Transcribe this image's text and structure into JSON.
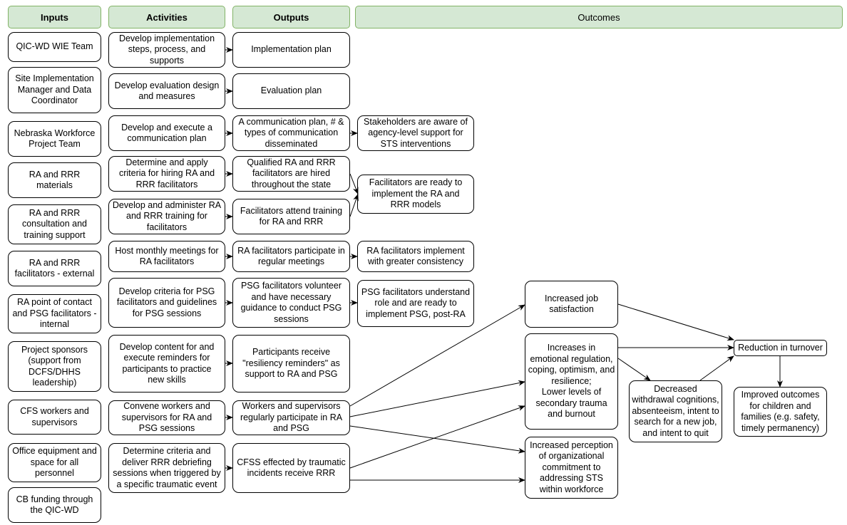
{
  "headers": {
    "inputs": "Inputs",
    "activities": "Activities",
    "outputs": "Outputs",
    "outcomes": "Outcomes"
  },
  "inputs": [
    "QIC-WD WIE Team",
    "Site Implementation\nManager and Data\nCoordinator",
    "Nebraska Workforce\nProject Team",
    "RA and RRR\nmaterials",
    "RA and RRR\nconsultation and\ntraining support",
    "RA and RRR\nfacilitators - external",
    "RA point of contact\nand PSG facilitators -\ninternal",
    "Project sponsors\n(support from\nDCFS/DHHS\nleadership)",
    "CFS workers and\nsupervisors",
    "Office equipment and\nspace for all\npersonnel",
    "CB funding through\nthe QIC-WD"
  ],
  "activities": [
    "Develop implementation\nsteps, process, and\nsupports",
    "Develop evaluation design\nand measures",
    "Develop and execute a\ncommunication plan",
    "Determine and apply\ncriteria for hiring RA and\nRRR facilitators",
    "Develop and administer RA\nand RRR training for\nfacilitators",
    "Host monthly meetings for\nRA facilitators",
    "Develop criteria for PSG\nfacilitators and guidelines\nfor PSG sessions",
    "Develop content for and\nexecute reminders for\nparticipants to practice\nnew skills",
    "Convene workers and\nsupervisors for RA and\nPSG sessions",
    "Determine criteria and\ndeliver RRR debriefing\nsessions when triggered by\na specific traumatic event"
  ],
  "outputs": [
    "Implementation plan",
    "Evaluation plan",
    "A communication plan, # &\ntypes of communication\ndisseminated",
    "Qualified RA and RRR\nfacilitators are hired\nthroughout the state",
    "Facilitators attend training\nfor RA and RRR",
    "RA facilitators participate in\nregular meetings",
    "PSG facilitators volunteer\nand have necessary\nguidance to conduct PSG\nsessions",
    "Participants receive\n\"resiliency reminders\" as\nsupport to RA and PSG",
    "Workers and supervisors\nregularly participate in RA\nand PSG",
    "CFSS effected by traumatic\nincidents receive RRR"
  ],
  "short_outcomes": [
    "Stakeholders are aware of\nagency-level support for\nSTS interventions",
    "Facilitators are ready to\nimplement the RA and\nRRR models",
    "RA facilitators implement\nwith greater consistency",
    "PSG facilitators understand\nrole and are ready to\nimplement PSG, post-RA"
  ],
  "mid_outcomes": [
    "Increased job\nsatisfaction",
    "Increases in\nemotional regulation,\ncoping, optimism, and\nresilience;\nLower levels of\nsecondary trauma\nand burnout",
    "Increased perception\nof organizational\ncommitment to\naddressing STS\nwithin workforce"
  ],
  "long_outcomes": {
    "withdrawal": "Decreased\nwithdrawal cognitions,\nabsenteeism, intent to\nsearch for a new job,\nand intent to quit",
    "turnover": "Reduction in turnover",
    "improved": "Improved outcomes\nfor children and\nfamilies (e.g. safety,\ntimely permanency)"
  },
  "colors": {
    "header_fill": "#d5e8d4",
    "header_border": "#82b366",
    "box_border": "#000000"
  }
}
